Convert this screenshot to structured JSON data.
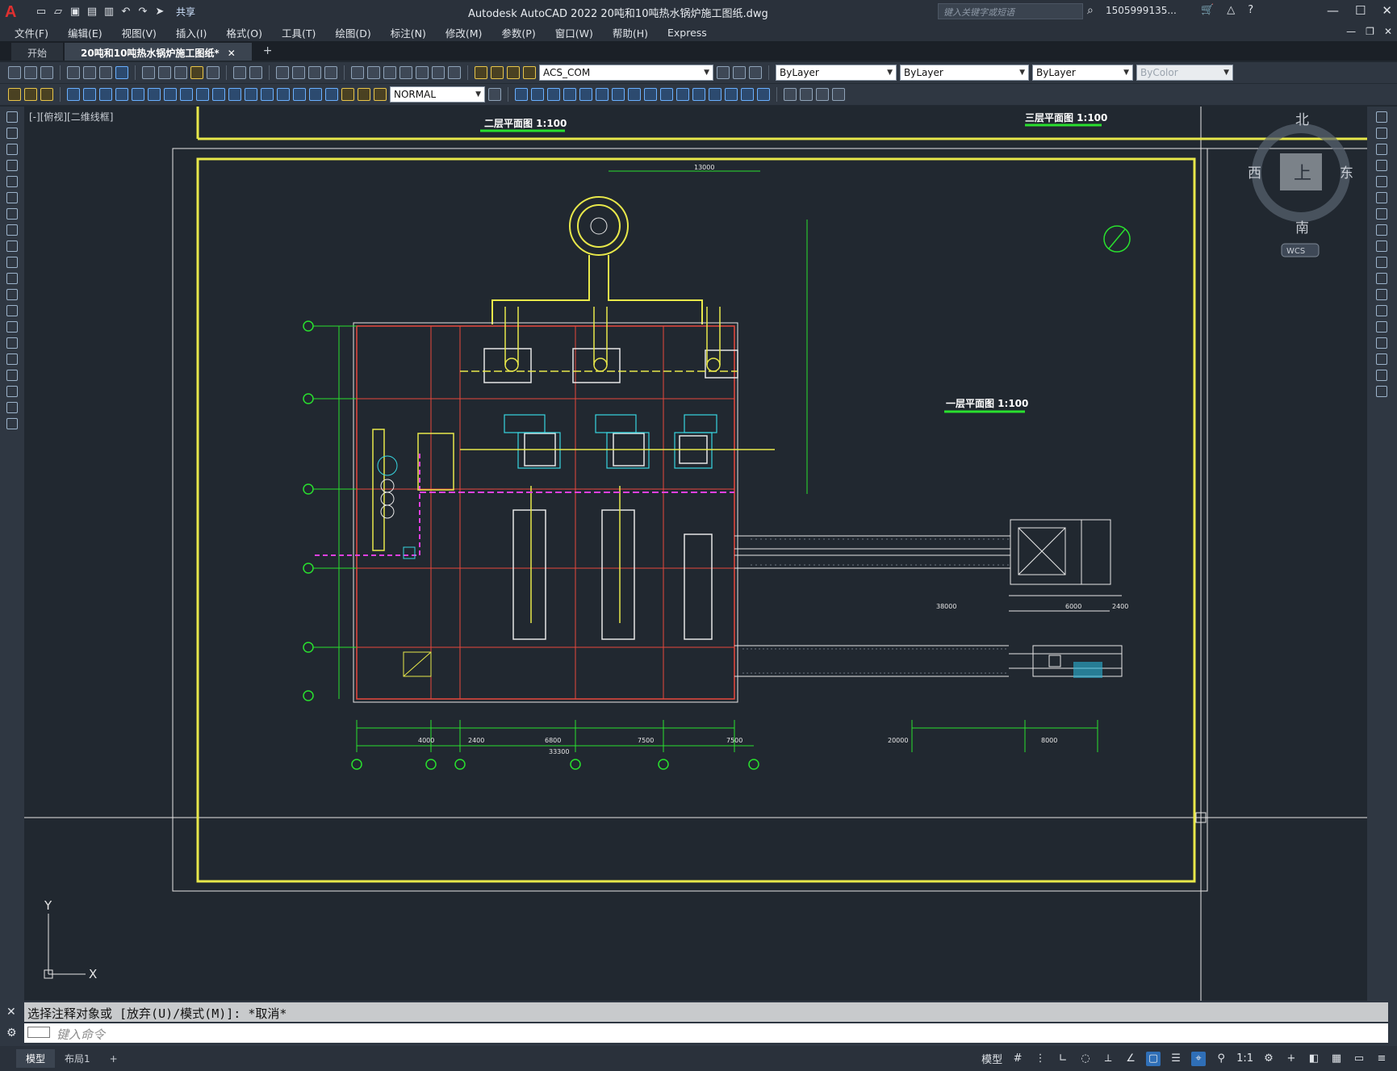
{
  "app": {
    "logo": "A",
    "share_label": "共享",
    "window_title": "Autodesk AutoCAD 2022    20吨和10吨热水锅炉施工图纸.dwg",
    "search_placeholder": "键入关键字或短语",
    "user_name": "1505999135...",
    "help": "?"
  },
  "menu": [
    "文件(F)",
    "编辑(E)",
    "视图(V)",
    "插入(I)",
    "格式(O)",
    "工具(T)",
    "绘图(D)",
    "标注(N)",
    "修改(M)",
    "参数(P)",
    "窗口(W)",
    "帮助(H)",
    "Express"
  ],
  "tabs": [
    {
      "label": "开始"
    },
    {
      "label": "20吨和10吨热水锅炉施工图纸*"
    }
  ],
  "toolbar": {
    "layer": "ACS_COM",
    "linetype_color": "ByLayer",
    "linetype": "ByLayer",
    "lineweight": "ByLayer",
    "plotstyle": "ByColor",
    "dimstyle": "NORMAL"
  },
  "viewport": {
    "label": "[-][俯视][二维线框]",
    "viewcube": {
      "north": "北",
      "south": "南",
      "west": "西",
      "east": "东",
      "face": "上",
      "wcs": "WCS"
    },
    "ucs": {
      "x": "X",
      "y": "Y"
    }
  },
  "drawing": {
    "title_second": "二层平面图   1:100",
    "title_third": "三层平面图   1:100",
    "title_first": "一层平面图   1:100",
    "dims_bottom_row1": [
      "4000",
      "2400",
      "6800",
      "7500",
      "7500",
      "20000",
      "8000"
    ],
    "dims_bottom_total": "33300",
    "dim_top": "13000",
    "dim_right_bottom": [
      "38000",
      "6000",
      "2400"
    ]
  },
  "command": {
    "history": "选择注释对象或 [放弃(U)/模式(M)]: *取消*",
    "placeholder": "键入命令"
  },
  "status": {
    "tabs": [
      "模型",
      "布局1"
    ],
    "model_label": "模型",
    "scale": "1:1"
  }
}
